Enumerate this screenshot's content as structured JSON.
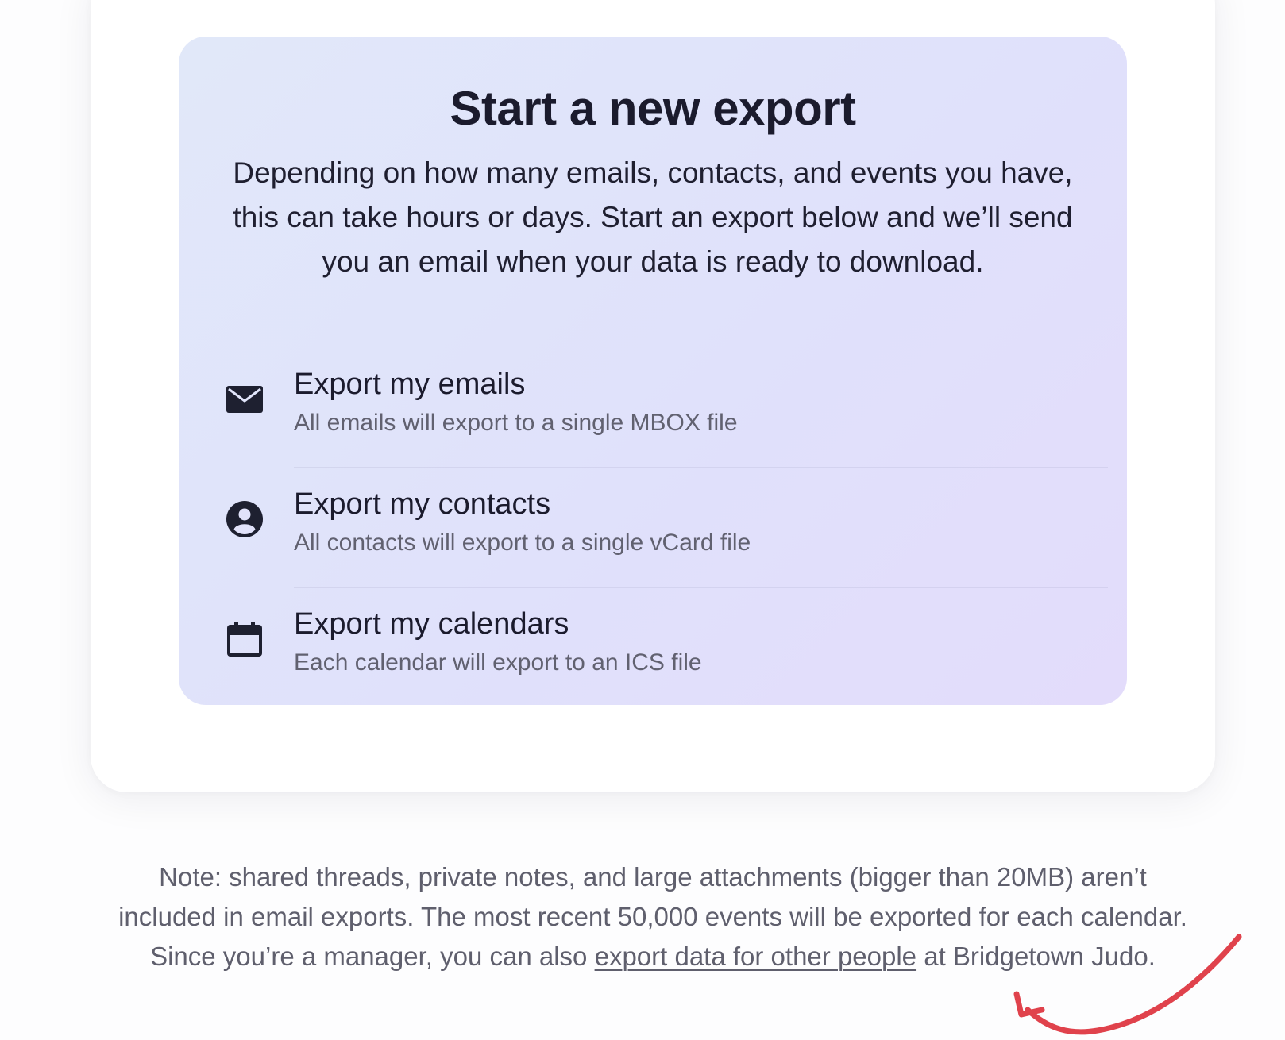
{
  "export_panel": {
    "title": "Start a new export",
    "description": "Depending on how many emails, contacts, and events you have, this can take hours or days. Start an export below and we’ll send you an email when your data is ready to download.",
    "options": [
      {
        "icon": "envelope-icon",
        "title": "Export my emails",
        "subtitle": "All emails will export to a single MBOX file"
      },
      {
        "icon": "user-circle-icon",
        "title": "Export my contacts",
        "subtitle": "All contacts will export to a single vCard file"
      },
      {
        "icon": "calendar-icon",
        "title": "Export my calendars",
        "subtitle": "Each calendar will export to an ICS file"
      }
    ]
  },
  "note": {
    "text_before_link": "Note: shared threads, private notes, and large attachments (bigger than 20MB) aren’t included in email exports. The most recent 50,000 events will be exported for each calendar. Since you’re a manager, you can also ",
    "link_text": "export data for other people",
    "text_after_link": " at Bridgetown Judo."
  },
  "colors": {
    "panel_gradient_start": "#e1e8f9",
    "panel_gradient_end": "#e3dcfb",
    "text_primary": "#1b1b2d",
    "text_secondary": "#616170",
    "annotation_arrow": "#e0424c"
  }
}
